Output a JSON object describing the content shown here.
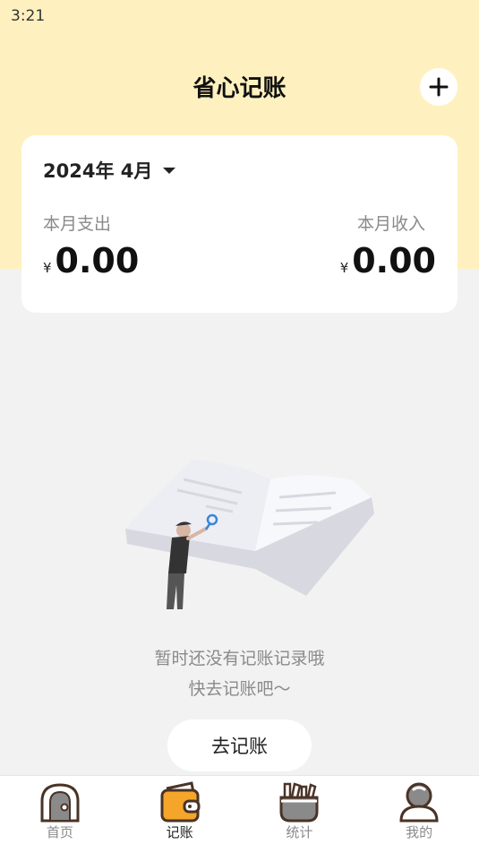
{
  "status_bar": {
    "time": "3:21"
  },
  "header": {
    "title": "省心记账",
    "add_icon": "plus-icon"
  },
  "summary": {
    "month": "2024年 4月",
    "expense_label": "本月支出",
    "income_label": "本月收入",
    "currency": "¥",
    "expense_value": "0.00",
    "income_value": "0.00"
  },
  "empty_state": {
    "line1": "暂时还没有记账记录哦",
    "line2": "快去记账吧～",
    "button_label": "去记账"
  },
  "tabbar": {
    "active": "记账",
    "items": [
      {
        "label": "首页",
        "icon": "home-icon"
      },
      {
        "label": "记账",
        "icon": "wallet-icon"
      },
      {
        "label": "统计",
        "icon": "stats-icon"
      },
      {
        "label": "我的",
        "icon": "profile-icon"
      }
    ]
  },
  "colors": {
    "accent": "#fff1bf",
    "icon_brown": "#4a3326",
    "icon_orange": "#f5a62a"
  }
}
